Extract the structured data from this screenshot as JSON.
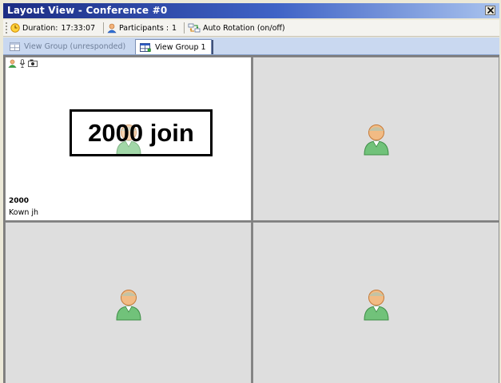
{
  "window": {
    "title": "Layout View - Conference #0",
    "close_icon": "close-icon"
  },
  "toolbar": {
    "duration_label": "Duration:",
    "duration_value": "17:33:07",
    "participants_label": "Participants :",
    "participants_value": "1",
    "auto_rotation_label": "Auto Rotation (on/off)"
  },
  "tabs": [
    {
      "label": "View Group (unresponded)",
      "active": false,
      "icon": "grid-view-icon"
    },
    {
      "label": "View Group 1",
      "active": true,
      "icon": "grid-view-icon"
    }
  ],
  "video_cells": [
    {
      "number": "2000",
      "name": "Kown jh",
      "active": true,
      "status_icons": [
        "participant-icon",
        "microphone-icon",
        "camera-icon"
      ]
    },
    {
      "number": "",
      "name": "",
      "active": false
    },
    {
      "number": "",
      "name": "",
      "active": false
    },
    {
      "number": "",
      "name": "",
      "active": false
    }
  ],
  "overlay": {
    "text": "2000 join"
  },
  "colors": {
    "titlebar_start": "#1c2d84",
    "titlebar_end": "#a9c3ee",
    "tabbar_bg": "#c9d8f0",
    "empty_cell_bg": "#dedede"
  }
}
